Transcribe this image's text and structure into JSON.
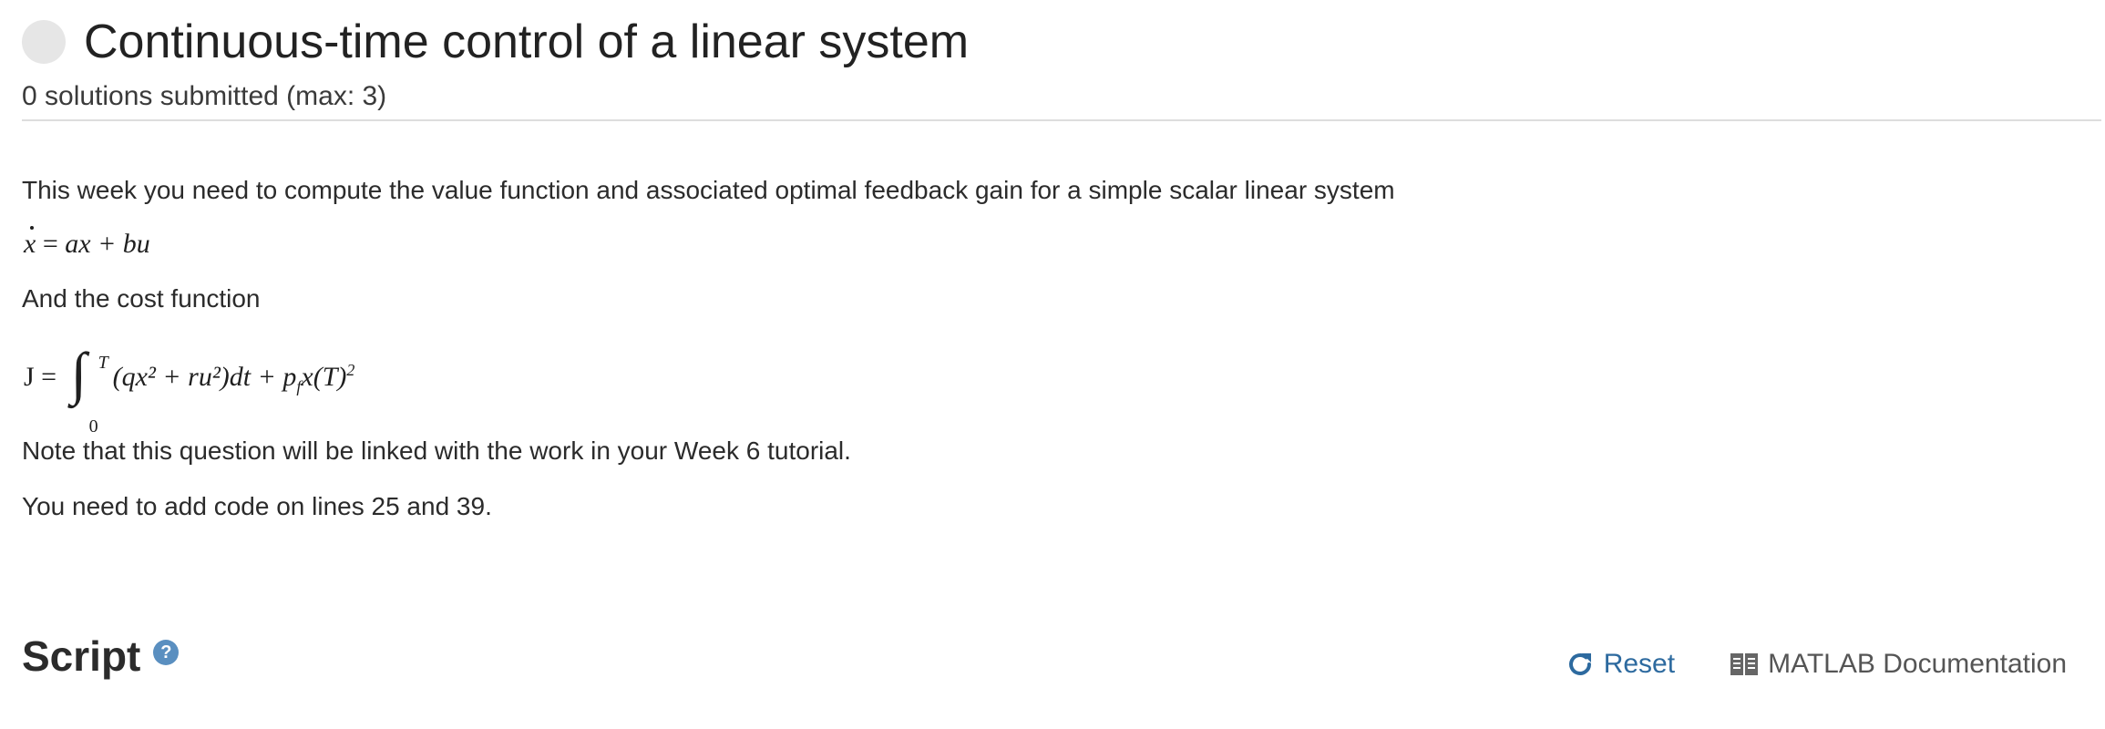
{
  "header": {
    "title": "Continuous-time control of a linear system",
    "submissions": "0 solutions submitted (max: 3)"
  },
  "description": {
    "intro": "This week you need to compute the value function and associated optimal feedback gain for a simple scalar linear system",
    "cost_intro": "And the cost function",
    "note": "Note that this question will be linked with the work in your Week 6 tutorial.",
    "instruction": "You need to add code on lines 25 and 39."
  },
  "equations": {
    "system": {
      "lhs": "x",
      "eq": " = ",
      "rhs": "ax + bu"
    },
    "cost": {
      "lhs": "J = ",
      "upper": "T",
      "lower": "0",
      "integrand": "(qx² + ru²)dt + p",
      "sub": "f",
      "terminal": "x(T)",
      "power": "2"
    }
  },
  "script": {
    "heading": "Script",
    "help_icon": "question-circle-icon",
    "help_glyph": "?",
    "reset_label": "Reset",
    "reset_icon": "refresh-icon",
    "docs_label": "MATLAB Documentation",
    "docs_icon": "book-icon"
  },
  "colors": {
    "link": "#2d6a9f",
    "help_icon_bg": "#5a8fc0",
    "status_circle": "#e6e6e6"
  }
}
